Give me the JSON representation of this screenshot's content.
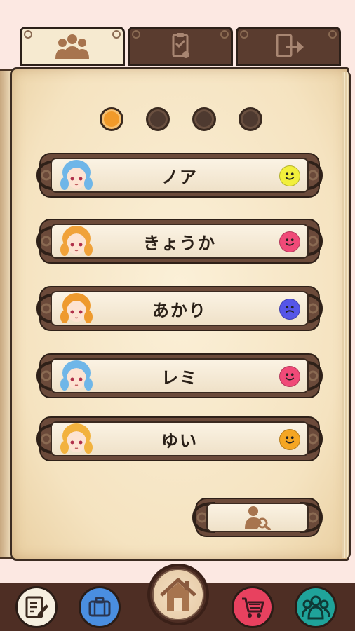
{
  "tabs": [
    {
      "icon": "group-icon",
      "active": true
    },
    {
      "icon": "checklist-icon",
      "active": false
    },
    {
      "icon": "exit-icon",
      "active": false
    }
  ],
  "pager": {
    "total": 4,
    "current": 1
  },
  "characters": [
    {
      "name": "ノア",
      "hair": "#6fb6e8",
      "mood_color": "#f2ef3c",
      "mood": "happy"
    },
    {
      "name": "きょうか",
      "hair": "#f0a23a",
      "mood_color": "#f04a78",
      "mood": "happy"
    },
    {
      "name": "あかり",
      "hair": "#ee9a2e",
      "mood_color": "#5656e8",
      "mood": "sad"
    },
    {
      "name": "レミ",
      "hair": "#6fb6e8",
      "mood_color": "#f04a78",
      "mood": "happy"
    },
    {
      "name": "ゆい",
      "hair": "#f2b23e",
      "mood_color": "#f5a623",
      "mood": "happy"
    }
  ],
  "search_button": {
    "icon": "user-search-icon"
  },
  "bottom_nav": [
    {
      "icon": "notebook-icon",
      "color": "#f6efe0"
    },
    {
      "icon": "briefcase-icon",
      "color": "#4a8ee0"
    },
    {
      "icon": "home-icon",
      "color": "#f2dec2"
    },
    {
      "icon": "cart-icon",
      "color": "#e8415f"
    },
    {
      "icon": "friends-icon",
      "color": "#1fa39a"
    }
  ]
}
